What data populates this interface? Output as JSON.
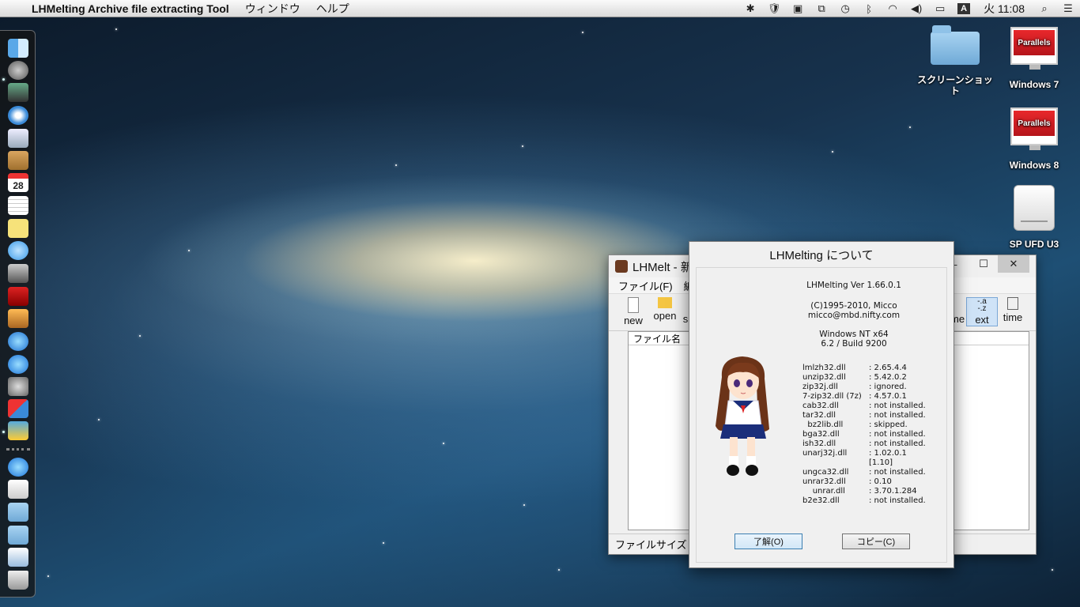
{
  "menubar": {
    "app_name": "LHMelting Archive file extracting Tool",
    "menus": [
      "ウィンドウ",
      "ヘルプ"
    ],
    "clock": "火 11:08",
    "input_method": "A"
  },
  "desktop": {
    "icons": [
      {
        "label": "スクリーンショット"
      },
      {
        "label": "Windows 7",
        "badge": "Parallels"
      },
      {
        "label": "Windows 8",
        "badge": "Parallels"
      },
      {
        "label": "SP UFD U3"
      }
    ],
    "calendar_day": "28"
  },
  "lhmelt_window": {
    "title": "LHMelt - 新",
    "menu": [
      "ファイル(F)",
      "編集"
    ],
    "toolbar": {
      "new": "new",
      "open": "open",
      "partial_s": "s",
      "partial_me": "me",
      "ext": "ext",
      "time": "time"
    },
    "column_header": "ファイル名　/",
    "status": "ファイルサイズ 0 (0)"
  },
  "about_dialog": {
    "title": "LHMelting について",
    "version": "LHMelting Ver 1.66.0.1",
    "copyright": "(C)1995-2010, Micco",
    "email": "micco@mbd.nifty.com",
    "os": "Windows NT x64",
    "build": "6.2 / Build 9200",
    "dlls": [
      {
        "name": "lmlzh32.dll",
        "value": ": 2.65.4.4"
      },
      {
        "name": "unzip32.dll",
        "value": ": 5.42.0.2"
      },
      {
        "name": "zip32j.dll",
        "value": ": ignored."
      },
      {
        "name": "7-zip32.dll (7z)",
        "value": ": 4.57.0.1"
      },
      {
        "name": "cab32.dll",
        "value": ": not installed."
      },
      {
        "name": "tar32.dll",
        "value": ": not installed."
      },
      {
        "name": "  bz2lib.dll",
        "value": ": skipped."
      },
      {
        "name": "bga32.dll",
        "value": ": not installed."
      },
      {
        "name": "ish32.dll",
        "value": ": not installed."
      },
      {
        "name": "unarj32j.dll",
        "value": ": 1.02.0.1 [1.10]"
      },
      {
        "name": "ungca32.dll",
        "value": ": not installed."
      },
      {
        "name": "unrar32.dll",
        "value": ": 0.10"
      },
      {
        "name": "    unrar.dll",
        "value": ": 3.70.1.284"
      },
      {
        "name": "b2e32.dll",
        "value": ": not installed."
      }
    ],
    "ok_button": "了解(O)",
    "copy_button": "コピー(C)"
  }
}
